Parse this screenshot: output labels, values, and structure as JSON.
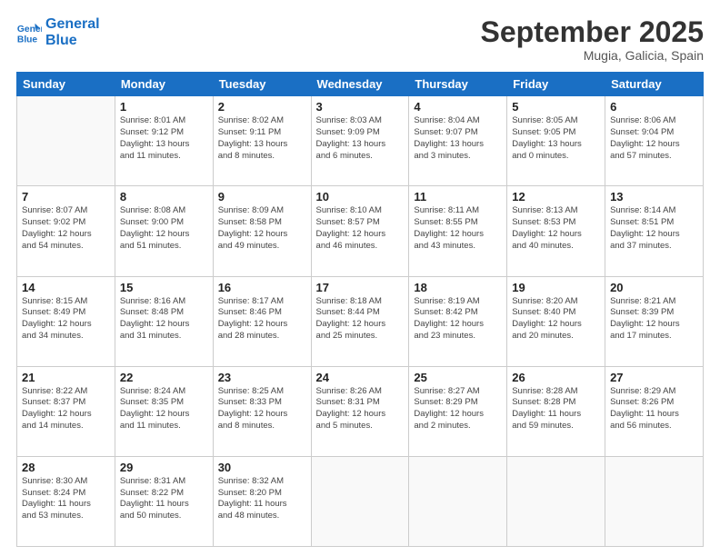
{
  "logo": {
    "line1": "General",
    "line2": "Blue"
  },
  "header": {
    "month": "September 2025",
    "location": "Mugia, Galicia, Spain"
  },
  "weekdays": [
    "Sunday",
    "Monday",
    "Tuesday",
    "Wednesday",
    "Thursday",
    "Friday",
    "Saturday"
  ],
  "weeks": [
    [
      {
        "day": "",
        "info": ""
      },
      {
        "day": "1",
        "info": "Sunrise: 8:01 AM\nSunset: 9:12 PM\nDaylight: 13 hours\nand 11 minutes."
      },
      {
        "day": "2",
        "info": "Sunrise: 8:02 AM\nSunset: 9:11 PM\nDaylight: 13 hours\nand 8 minutes."
      },
      {
        "day": "3",
        "info": "Sunrise: 8:03 AM\nSunset: 9:09 PM\nDaylight: 13 hours\nand 6 minutes."
      },
      {
        "day": "4",
        "info": "Sunrise: 8:04 AM\nSunset: 9:07 PM\nDaylight: 13 hours\nand 3 minutes."
      },
      {
        "day": "5",
        "info": "Sunrise: 8:05 AM\nSunset: 9:05 PM\nDaylight: 13 hours\nand 0 minutes."
      },
      {
        "day": "6",
        "info": "Sunrise: 8:06 AM\nSunset: 9:04 PM\nDaylight: 12 hours\nand 57 minutes."
      }
    ],
    [
      {
        "day": "7",
        "info": "Sunrise: 8:07 AM\nSunset: 9:02 PM\nDaylight: 12 hours\nand 54 minutes."
      },
      {
        "day": "8",
        "info": "Sunrise: 8:08 AM\nSunset: 9:00 PM\nDaylight: 12 hours\nand 51 minutes."
      },
      {
        "day": "9",
        "info": "Sunrise: 8:09 AM\nSunset: 8:58 PM\nDaylight: 12 hours\nand 49 minutes."
      },
      {
        "day": "10",
        "info": "Sunrise: 8:10 AM\nSunset: 8:57 PM\nDaylight: 12 hours\nand 46 minutes."
      },
      {
        "day": "11",
        "info": "Sunrise: 8:11 AM\nSunset: 8:55 PM\nDaylight: 12 hours\nand 43 minutes."
      },
      {
        "day": "12",
        "info": "Sunrise: 8:13 AM\nSunset: 8:53 PM\nDaylight: 12 hours\nand 40 minutes."
      },
      {
        "day": "13",
        "info": "Sunrise: 8:14 AM\nSunset: 8:51 PM\nDaylight: 12 hours\nand 37 minutes."
      }
    ],
    [
      {
        "day": "14",
        "info": "Sunrise: 8:15 AM\nSunset: 8:49 PM\nDaylight: 12 hours\nand 34 minutes."
      },
      {
        "day": "15",
        "info": "Sunrise: 8:16 AM\nSunset: 8:48 PM\nDaylight: 12 hours\nand 31 minutes."
      },
      {
        "day": "16",
        "info": "Sunrise: 8:17 AM\nSunset: 8:46 PM\nDaylight: 12 hours\nand 28 minutes."
      },
      {
        "day": "17",
        "info": "Sunrise: 8:18 AM\nSunset: 8:44 PM\nDaylight: 12 hours\nand 25 minutes."
      },
      {
        "day": "18",
        "info": "Sunrise: 8:19 AM\nSunset: 8:42 PM\nDaylight: 12 hours\nand 23 minutes."
      },
      {
        "day": "19",
        "info": "Sunrise: 8:20 AM\nSunset: 8:40 PM\nDaylight: 12 hours\nand 20 minutes."
      },
      {
        "day": "20",
        "info": "Sunrise: 8:21 AM\nSunset: 8:39 PM\nDaylight: 12 hours\nand 17 minutes."
      }
    ],
    [
      {
        "day": "21",
        "info": "Sunrise: 8:22 AM\nSunset: 8:37 PM\nDaylight: 12 hours\nand 14 minutes."
      },
      {
        "day": "22",
        "info": "Sunrise: 8:24 AM\nSunset: 8:35 PM\nDaylight: 12 hours\nand 11 minutes."
      },
      {
        "day": "23",
        "info": "Sunrise: 8:25 AM\nSunset: 8:33 PM\nDaylight: 12 hours\nand 8 minutes."
      },
      {
        "day": "24",
        "info": "Sunrise: 8:26 AM\nSunset: 8:31 PM\nDaylight: 12 hours\nand 5 minutes."
      },
      {
        "day": "25",
        "info": "Sunrise: 8:27 AM\nSunset: 8:29 PM\nDaylight: 12 hours\nand 2 minutes."
      },
      {
        "day": "26",
        "info": "Sunrise: 8:28 AM\nSunset: 8:28 PM\nDaylight: 11 hours\nand 59 minutes."
      },
      {
        "day": "27",
        "info": "Sunrise: 8:29 AM\nSunset: 8:26 PM\nDaylight: 11 hours\nand 56 minutes."
      }
    ],
    [
      {
        "day": "28",
        "info": "Sunrise: 8:30 AM\nSunset: 8:24 PM\nDaylight: 11 hours\nand 53 minutes."
      },
      {
        "day": "29",
        "info": "Sunrise: 8:31 AM\nSunset: 8:22 PM\nDaylight: 11 hours\nand 50 minutes."
      },
      {
        "day": "30",
        "info": "Sunrise: 8:32 AM\nSunset: 8:20 PM\nDaylight: 11 hours\nand 48 minutes."
      },
      {
        "day": "",
        "info": ""
      },
      {
        "day": "",
        "info": ""
      },
      {
        "day": "",
        "info": ""
      },
      {
        "day": "",
        "info": ""
      }
    ]
  ]
}
